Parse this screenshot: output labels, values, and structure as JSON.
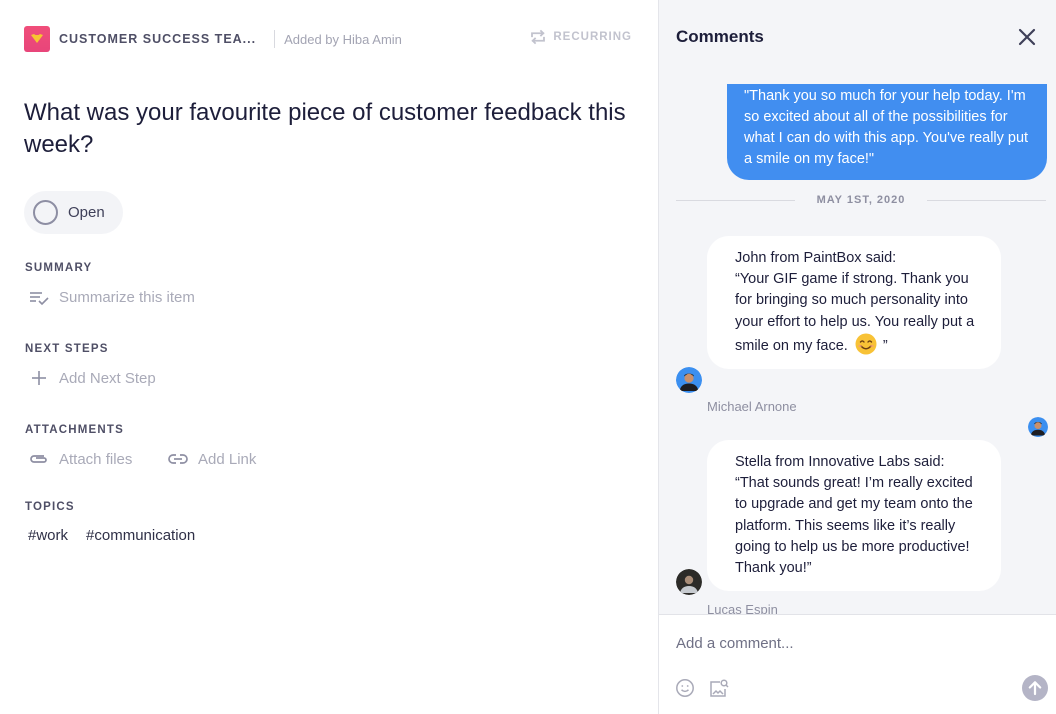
{
  "colors": {
    "accent_blue": "#418ef0",
    "team_logo": "#f04e7a",
    "heading_text": "#1d1e3a",
    "muted_text": "#a9aab8",
    "panel_bg": "#f4f5f8"
  },
  "header": {
    "team_name": "CUSTOMER SUCCESS TEA...",
    "added_by": "Added by Hiba Amin",
    "recurring_label": "RECURRING",
    "recurring_icon": "repeat-icon"
  },
  "item": {
    "title": "What was your favourite piece of customer feedback this week?",
    "status": "Open"
  },
  "sections": {
    "summary": {
      "label": "SUMMARY",
      "action": "Summarize this item",
      "icon": "summarize-icon"
    },
    "next_steps": {
      "label": "NEXT STEPS",
      "action": "Add Next Step",
      "icon": "plus-icon"
    },
    "attachments": {
      "label": "ATTACHMENTS",
      "attach_files": "Attach files",
      "add_link": "Add Link",
      "attach_icon": "paperclip-icon",
      "link_icon": "link-icon"
    },
    "topics": {
      "label": "TOPICS",
      "tags": [
        "#work",
        "#communication"
      ]
    }
  },
  "comments": {
    "title": "Comments",
    "close_icon": "close-icon",
    "outgoing": {
      "text": "\"Thank you so much for your help today. I'm so excited about all of the possibilities for what I can do with this app. You've really put a smile on my face!\""
    },
    "date_divider": "MAY 1ST, 2020",
    "messages": [
      {
        "intro": "John from PaintBox said:",
        "body": "“Your GIF game if strong. Thank you for bringing so much personality into your effort to help us. You really put a smile on my face.",
        "emoji": "smiling-face-emoji",
        "closing": " ”",
        "sender": "Michael Arnone"
      },
      {
        "intro": "Stella from Innovative Labs said:",
        "body": "“That sounds great! I’m really excited to upgrade and get my team onto the platform. This seems like it’s really going to help us be more productive! Thank you!”",
        "sender": "Lucas Espin"
      }
    ],
    "composer": {
      "placeholder": "Add a comment...",
      "emoji_icon": "emoji-icon",
      "image_icon": "image-search-icon",
      "send_icon": "send-arrow-icon"
    }
  }
}
